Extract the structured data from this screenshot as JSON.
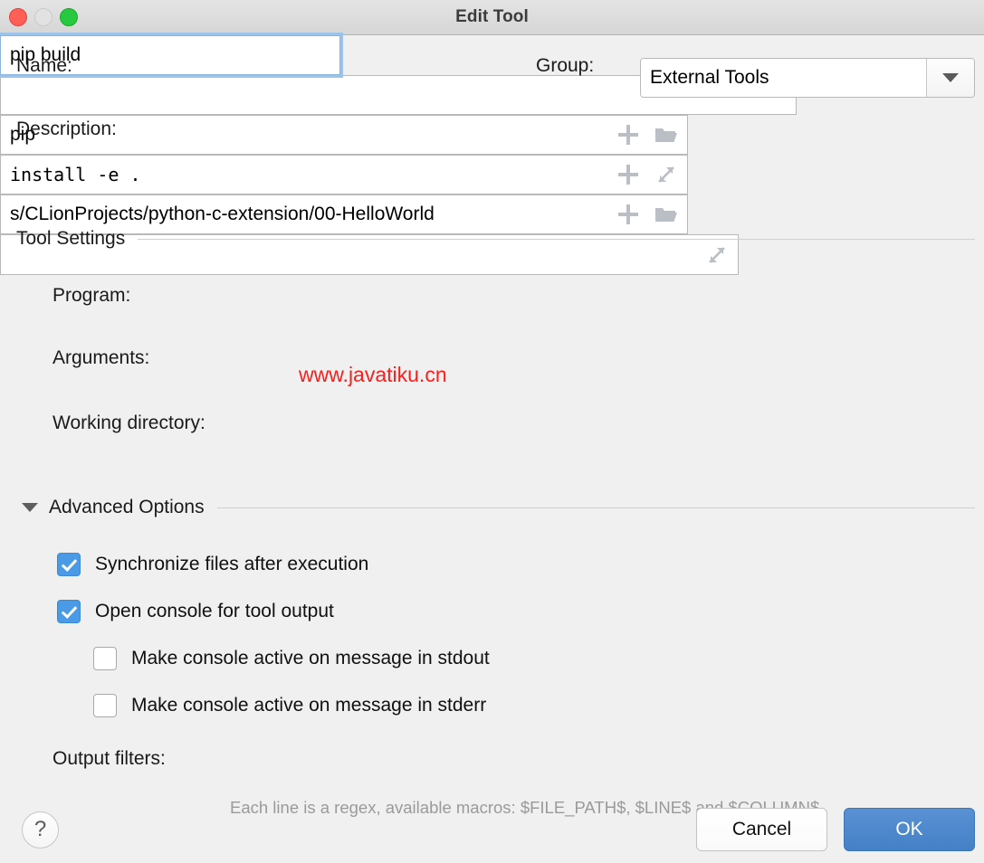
{
  "window": {
    "title": "Edit Tool",
    "traffic_lights": [
      "close",
      "minimize",
      "zoom"
    ]
  },
  "form": {
    "name_label": "Name:",
    "name_value": "pip build",
    "name_placeholder": "",
    "group_label": "Group:",
    "group_value": "External Tools",
    "group_options": [
      "External Tools"
    ],
    "description_label": "Description:",
    "description_value": "",
    "description_placeholder": ""
  },
  "tool_settings": {
    "section_label": "Tool Settings",
    "program_label": "Program:",
    "program_value": "pip",
    "arguments_label": "Arguments:",
    "arguments_value": "install -e .",
    "working_directory_label": "Working directory:",
    "working_directory_value": "s/CLionProjects/python-c-extension/00-HelloWorld"
  },
  "advanced": {
    "section_label": "Advanced Options",
    "options": [
      {
        "label": "Synchronize files after execution",
        "checked": true
      },
      {
        "label": "Open console for tool output",
        "checked": true
      },
      {
        "label": "Make console active on message in stdout",
        "checked": false
      },
      {
        "label": "Make console active on message in stderr",
        "checked": false
      }
    ],
    "output_filters_label": "Output filters:",
    "output_filters_value": "",
    "output_filters_hint": "Each line is a regex, available macros: $FILE_PATH$, $LINE$ and $COLUMN$"
  },
  "footer": {
    "help_label": "?",
    "cancel_label": "Cancel",
    "ok_label": "OK"
  },
  "watermark": {
    "text": "www.javatiku.cn",
    "color": "#fc1d1d"
  },
  "colors": {
    "accent": "#4a9ae8",
    "default_button": "#4480c6",
    "background": "#f0f0f0",
    "field_border": "#b9b9b9",
    "focus_ring": "#9cc4ea"
  },
  "icons": {
    "plus": "plus-icon",
    "folder": "folder-icon",
    "expand": "expand-icon",
    "chevron_down": "chevron-down-icon",
    "disclosure": "disclosure-triangle-icon"
  }
}
